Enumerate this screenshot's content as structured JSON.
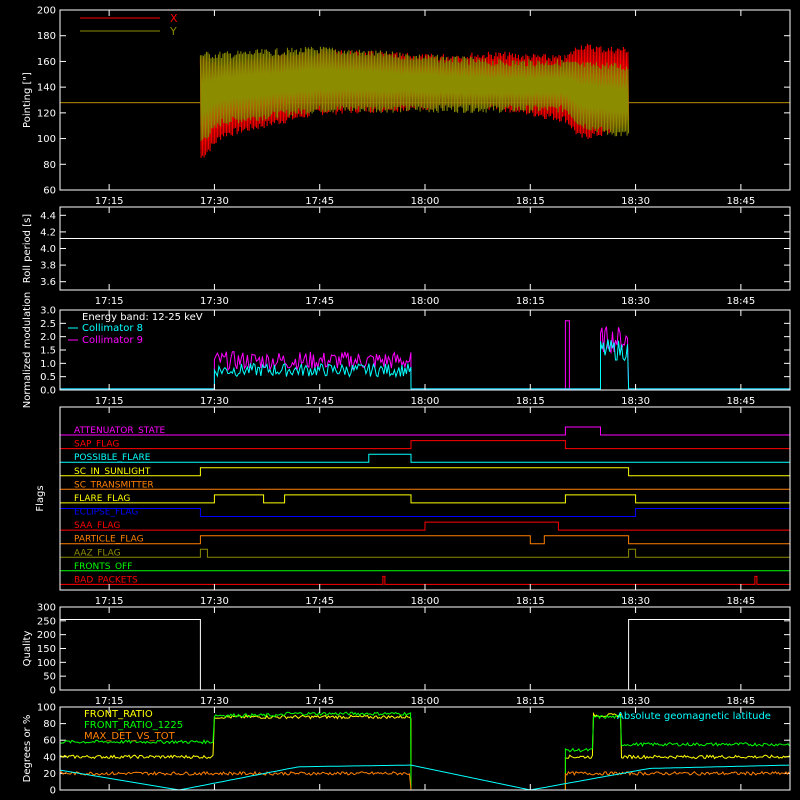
{
  "xaxis": {
    "range": [
      "17:08",
      "18:52"
    ],
    "ticks": [
      "17:15",
      "17:30",
      "17:45",
      "18:00",
      "18:15",
      "18:30",
      "18:45"
    ]
  },
  "colors": {
    "axes": "#ffffff",
    "red": "#ff0000",
    "olive": "#8c8c00",
    "cyan": "#00ffff",
    "magenta": "#ff00ff",
    "green": "#00ff00",
    "yellow": "#ffff00",
    "orange": "#ff8000",
    "blue": "#0000ff",
    "gray": "#aaaaaa"
  },
  "chart_data": [
    {
      "type": "line",
      "ylabel": "Pointing [\"]",
      "ylim": [
        60,
        200
      ],
      "yticks": [
        60,
        80,
        100,
        120,
        140,
        160,
        180,
        200
      ],
      "legend_placement": "top-left",
      "series": [
        {
          "name": "X",
          "color": "#ff0000",
          "baseline": 128,
          "envelope": {
            "x": [
              "17:28",
              "17:31",
              "17:45",
              "18:00",
              "18:10",
              "18:20",
              "18:22",
              "18:26",
              "18:29"
            ],
            "upper": [
              165,
              160,
              170,
              166,
              168,
              165,
              175,
              172,
              172
            ],
            "lower": [
              82,
              100,
              118,
              122,
              122,
              112,
              98,
              102,
              110
            ]
          }
        },
        {
          "name": "Y",
          "color": "#8c8c00",
          "baseline": 128,
          "envelope": {
            "x": [
              "17:28",
              "17:31",
              "17:45",
              "18:00",
              "18:10",
              "18:20",
              "18:22",
              "18:26",
              "18:29"
            ],
            "upper": [
              168,
              168,
              172,
              166,
              162,
              162,
              160,
              160,
              158
            ],
            "lower": [
              95,
              110,
              120,
              120,
              120,
              120,
              108,
              102,
              100
            ]
          }
        }
      ]
    },
    {
      "type": "line",
      "ylabel": "Roll period [s]",
      "ylim": [
        3.5,
        4.5
      ],
      "yticks": [
        3.6,
        3.8,
        4.0,
        4.2,
        4.4
      ],
      "series": [
        {
          "color": "#ffffff",
          "x": [
            "17:08",
            "18:52"
          ],
          "y": [
            4.12,
            4.12
          ]
        }
      ]
    },
    {
      "type": "line",
      "ylabel": "Normalized modulation",
      "ylim": [
        0,
        3.0
      ],
      "yticks": [
        0.0,
        0.5,
        1.0,
        1.5,
        2.0,
        2.5,
        3.0
      ],
      "legend_title": "Energy band: 12-25 keV",
      "series": [
        {
          "name": "Collimator 8",
          "color": "#00ffff",
          "segments": [
            {
              "x": [
                "17:30",
                "17:58"
              ],
              "center": 0.75,
              "amp": 0.25
            },
            {
              "x": [
                "18:25",
                "18:29"
              ],
              "center": 1.5,
              "amp": 0.4
            }
          ]
        },
        {
          "name": "Collimator 9",
          "color": "#ff00ff",
          "segments": [
            {
              "x": [
                "17:30",
                "17:58"
              ],
              "center": 1.1,
              "amp": 0.35
            },
            {
              "x": [
                "18:25",
                "18:29"
              ],
              "center": 1.9,
              "amp": 0.5
            }
          ],
          "spike": {
            "x": [
              "18:20",
              "18:25"
            ],
            "y": 2.6
          }
        }
      ]
    },
    {
      "type": "table",
      "ylabel": "Flags",
      "flags": [
        {
          "name": "ATTENUATOR_STATE",
          "color": "#ff00ff",
          "on": [
            [
              "18:20",
              "18:25"
            ]
          ]
        },
        {
          "name": "SAP_FLAG",
          "color": "#ff0000",
          "on": [
            [
              "17:58",
              "18:20"
            ]
          ]
        },
        {
          "name": "POSSIBLE_FLARE",
          "color": "#00ffff",
          "on": [
            [
              "17:52",
              "17:58"
            ]
          ]
        },
        {
          "name": "SC_IN_SUNLIGHT",
          "color": "#ffff00",
          "on": [
            [
              "17:28",
              "18:29"
            ]
          ]
        },
        {
          "name": "SC_TRANSMITTER",
          "color": "#ff8000",
          "on": []
        },
        {
          "name": "FLARE_FLAG",
          "color": "#ffff00",
          "on": [
            [
              "17:30",
              "17:37"
            ],
            [
              "17:40",
              "17:58"
            ],
            [
              "18:20",
              "18:30"
            ]
          ]
        },
        {
          "name": "ECLIPSE_FLAG",
          "color": "#0000ff",
          "on": [
            [
              "17:08",
              "17:28"
            ],
            [
              "18:30",
              "18:52"
            ]
          ]
        },
        {
          "name": "SAA_FLAG",
          "color": "#ff0000",
          "on": [
            [
              "18:00",
              "18:19"
            ]
          ]
        },
        {
          "name": "PARTICLE_FLAG",
          "color": "#ff8000",
          "on": [
            [
              "17:28",
              "18:15"
            ],
            [
              "18:17",
              "18:29"
            ]
          ]
        },
        {
          "name": "AAZ_FLAG",
          "color": "#8c8c00",
          "on": [
            [
              "17:28",
              "17:29"
            ],
            [
              "18:29",
              "18:30"
            ]
          ]
        },
        {
          "name": "FRONTS_OFF",
          "color": "#00ff00",
          "on": []
        },
        {
          "name": "BAD_PACKETS",
          "color": "#ff0000",
          "on": [
            [
              "17:54",
              "17:54"
            ],
            [
              "18:47",
              "18:47"
            ]
          ]
        }
      ]
    },
    {
      "type": "line",
      "ylabel": "Quality",
      "ylim": [
        0,
        300
      ],
      "yticks": [
        0,
        50,
        100,
        150,
        200,
        250,
        300
      ],
      "series": [
        {
          "color": "#ffffff",
          "x": [
            "17:08",
            "17:28",
            "17:28",
            "18:29",
            "18:29",
            "18:52"
          ],
          "y": [
            255,
            255,
            0,
            0,
            255,
            255
          ]
        }
      ]
    },
    {
      "type": "line",
      "ylabel": "Degrees or %",
      "ylim": [
        0,
        100
      ],
      "yticks": [
        0,
        20,
        40,
        60,
        80,
        100
      ],
      "series": [
        {
          "name": "FRONT_RATIO",
          "color": "#ffff00",
          "levels": [
            [
              "17:08",
              "17:30",
              40
            ],
            [
              "17:30",
              "17:58",
              88
            ],
            [
              "18:20",
              "18:24",
              40
            ],
            [
              "18:24",
              "18:28",
              90
            ],
            [
              "18:28",
              "18:52",
              40
            ]
          ]
        },
        {
          "name": "FRONT_RATIO_1225",
          "color": "#00ff00",
          "levels": [
            [
              "17:08",
              "17:30",
              58
            ],
            [
              "17:30",
              "17:40",
              90
            ],
            [
              "17:40",
              "17:58",
              92
            ],
            [
              "18:20",
              "18:24",
              48
            ],
            [
              "18:24",
              "18:28",
              88
            ],
            [
              "18:28",
              "18:52",
              55
            ]
          ]
        },
        {
          "name": "MAX_DET_VS_TOT",
          "color": "#ff8000",
          "levels": [
            [
              "17:08",
              "17:58",
              20
            ],
            [
              "18:20",
              "18:52",
              20
            ]
          ]
        },
        {
          "name": "Absolute geomagnetic latitude",
          "color": "#00ffff",
          "x": [
            "17:08",
            "17:25",
            "17:42",
            "17:58",
            "18:15",
            "18:32",
            "18:52"
          ],
          "y": [
            24,
            0,
            28,
            30,
            0,
            26,
            30
          ]
        }
      ]
    }
  ]
}
